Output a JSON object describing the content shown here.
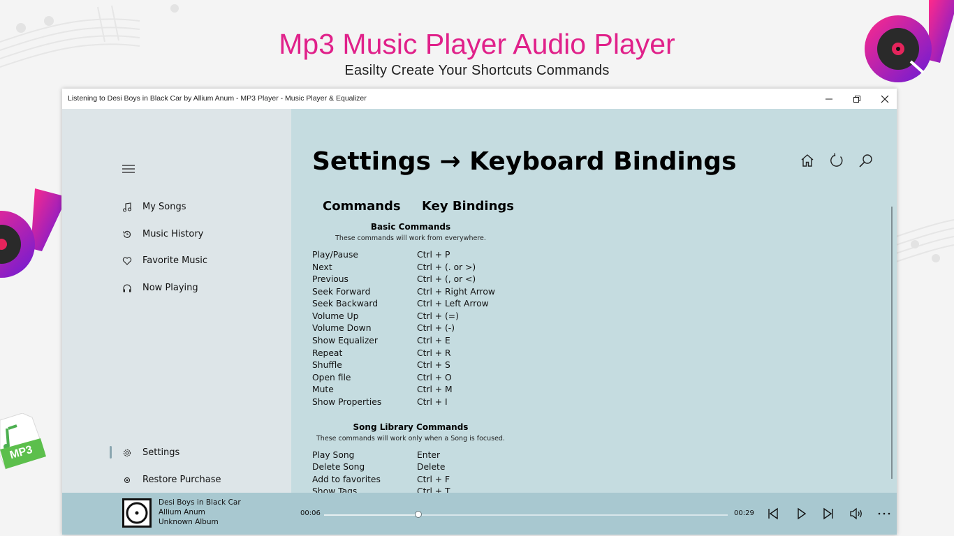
{
  "promo": {
    "title": "Mp3 Music Player Audio Player",
    "subtitle": "Easilty Create Your Shortcuts Commands",
    "badge": "MP3"
  },
  "window": {
    "title": "Listening to Desi Boys in Black Car by Allium Anum - MP3 Player - Music Player & Equalizer"
  },
  "sidebar": {
    "items": [
      {
        "label": "My Songs",
        "icon": "music-note-icon"
      },
      {
        "label": "Music History",
        "icon": "history-icon"
      },
      {
        "label": "Favorite Music",
        "icon": "heart-icon"
      },
      {
        "label": "Now Playing",
        "icon": "headphones-icon"
      }
    ],
    "bottom_items": [
      {
        "label": "Settings",
        "icon": "gear-icon"
      },
      {
        "label": "Restore Purchase",
        "icon": "restore-icon"
      }
    ]
  },
  "main": {
    "title": "Settings → Keyboard Bindings",
    "col_commands": "Commands",
    "col_bindings": "Key Bindings",
    "basic": {
      "title": "Basic Commands",
      "desc": "These commands will work from everywhere.",
      "rows": [
        {
          "cmd": "Play/Pause",
          "key": "Ctrl + P"
        },
        {
          "cmd": "Next",
          "key": "Ctrl + (. or >)"
        },
        {
          "cmd": "Previous",
          "key": "Ctrl + (, or <)"
        },
        {
          "cmd": "Seek Forward",
          "key": "Ctrl + Right Arrow"
        },
        {
          "cmd": "Seek Backward",
          "key": "Ctrl + Left Arrow"
        },
        {
          "cmd": "Volume Up",
          "key": "Ctrl + (=)"
        },
        {
          "cmd": "Volume Down",
          "key": "Ctrl + (-)"
        },
        {
          "cmd": "Show Equalizer",
          "key": "Ctrl + E"
        },
        {
          "cmd": "Repeat",
          "key": "Ctrl + R"
        },
        {
          "cmd": "Shuffle",
          "key": "Ctrl + S"
        },
        {
          "cmd": "Open file",
          "key": "Ctrl + O"
        },
        {
          "cmd": "Mute",
          "key": "Ctrl + M"
        },
        {
          "cmd": "Show Properties",
          "key": "Ctrl + I"
        }
      ]
    },
    "library": {
      "title": "Song Library Commands",
      "desc": "These commands will work only when a Song is focused.",
      "rows": [
        {
          "cmd": "Play Song",
          "key": "Enter"
        },
        {
          "cmd": "Delete Song",
          "key": "Delete"
        },
        {
          "cmd": "Add to favorites",
          "key": "Ctrl + F"
        },
        {
          "cmd": "Show Tags",
          "key": "Ctrl + T"
        }
      ]
    }
  },
  "player": {
    "song": "Desi Boys in Black Car",
    "artist": "Allium Anum",
    "album": "Unknown Album",
    "elapsed": "00:06",
    "remaining": "00:29",
    "progress": 0.233
  },
  "colors": {
    "accent": "#e0218a",
    "sidebar": "#dde5e8",
    "main": "#c5dce0",
    "player": "#a8c8d0"
  }
}
